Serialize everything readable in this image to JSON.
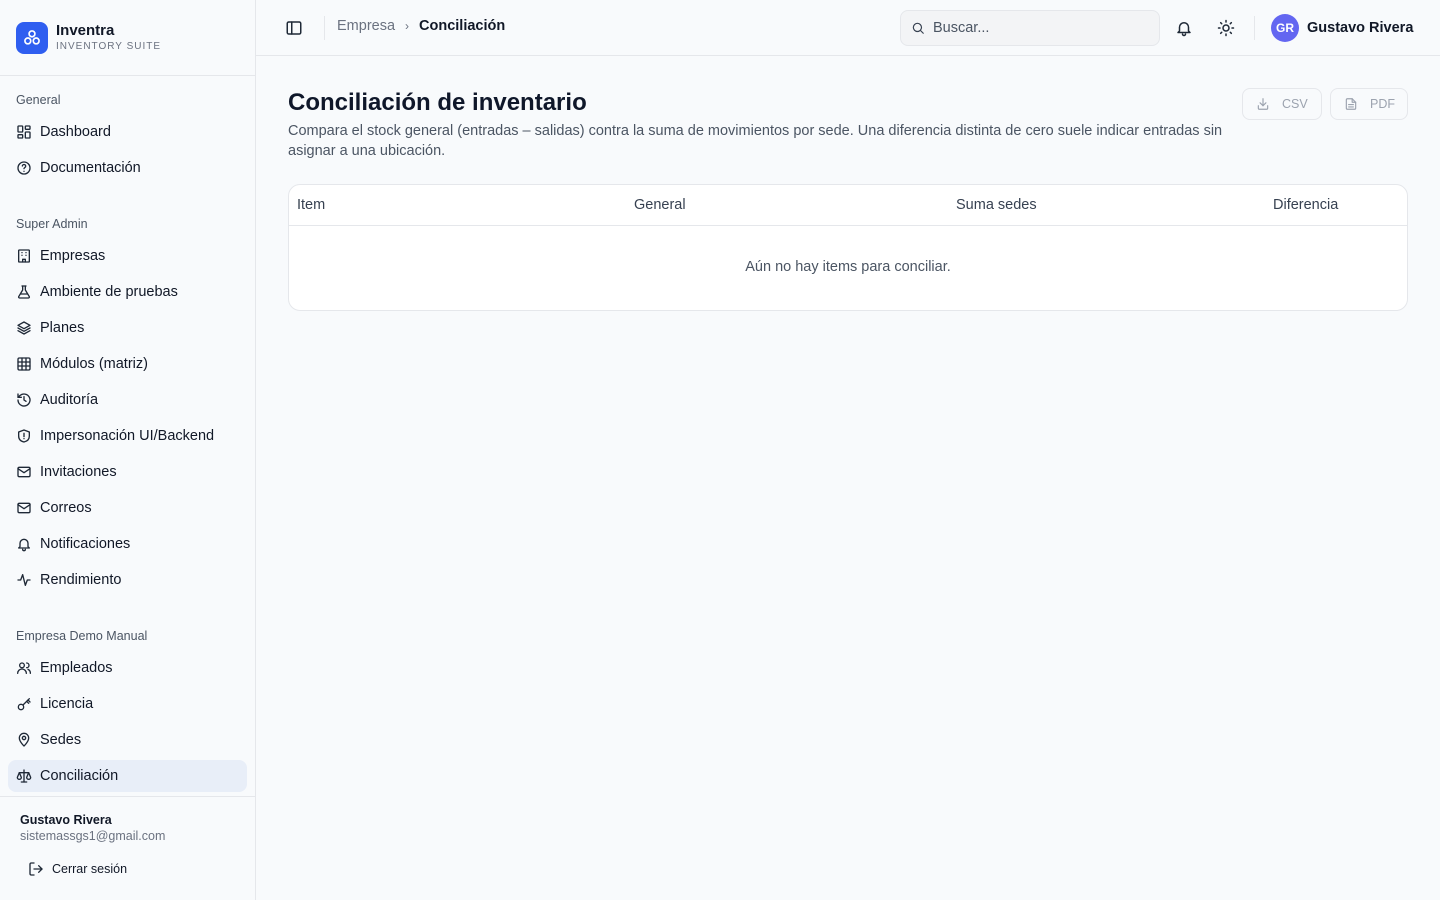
{
  "brand": {
    "name": "Inventra",
    "subtitle": "INVENTORY SUITE"
  },
  "sidebar": {
    "sections": [
      {
        "header": "General",
        "items": [
          {
            "label": "Dashboard",
            "icon": "dashboard-icon"
          },
          {
            "label": "Documentación",
            "icon": "help-circle-icon"
          }
        ]
      },
      {
        "header": "Super Admin",
        "items": [
          {
            "label": "Empresas",
            "icon": "building-icon"
          },
          {
            "label": "Ambiente de pruebas",
            "icon": "flask-icon"
          },
          {
            "label": "Planes",
            "icon": "layers-icon"
          },
          {
            "label": "Módulos (matriz)",
            "icon": "grid-icon"
          },
          {
            "label": "Auditoría",
            "icon": "history-icon"
          },
          {
            "label": "Impersonación UI/Backend",
            "icon": "shield-icon"
          },
          {
            "label": "Invitaciones",
            "icon": "mail-icon"
          },
          {
            "label": "Correos",
            "icon": "mail-icon"
          },
          {
            "label": "Notificaciones",
            "icon": "bell-icon"
          },
          {
            "label": "Rendimiento",
            "icon": "activity-icon"
          }
        ]
      },
      {
        "header": "Empresa Demo Manual",
        "items": [
          {
            "label": "Empleados",
            "icon": "users-icon"
          },
          {
            "label": "Licencia",
            "icon": "key-icon"
          },
          {
            "label": "Sedes",
            "icon": "map-pin-icon"
          },
          {
            "label": "Conciliación",
            "icon": "scale-icon",
            "active": true
          }
        ]
      }
    ],
    "footer": {
      "user_name": "Gustavo Rivera",
      "user_email": "sistemassgs1@gmail.com",
      "logout_label": "Cerrar sesión"
    }
  },
  "topbar": {
    "breadcrumb": [
      "Empresa",
      "Conciliación"
    ],
    "search_placeholder": "Buscar...",
    "user": {
      "initials": "GR",
      "name": "Gustavo Rivera"
    }
  },
  "main": {
    "title": "Conciliación de inventario",
    "description": "Compara el stock general (entradas – salidas) contra la suma de movimientos por sede. Una diferencia distinta de cero suele indicar entradas sin asignar a una ubicación.",
    "export_buttons": [
      "CSV",
      "PDF"
    ],
    "table": {
      "columns": [
        "Item",
        "General",
        "Suma sedes",
        "Diferencia"
      ],
      "rows": [],
      "empty_message": "Aún no hay items para conciliar."
    }
  },
  "colors": {
    "accent": "#2f5ef0",
    "avatar": "#6366f1",
    "active_nav_bg": "#e8eef8",
    "page_bg": "#f8fafc",
    "border": "#e5e7eb"
  }
}
